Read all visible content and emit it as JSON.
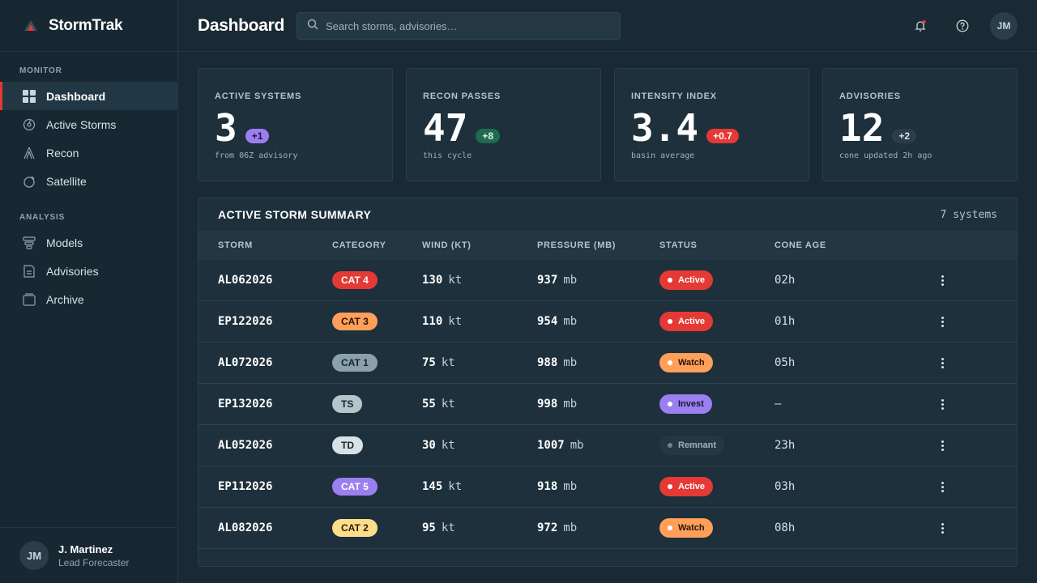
{
  "app": {
    "name": "StormTrak",
    "logo_color": "#e53935"
  },
  "sidebar": {
    "sections": [
      {
        "title": "MONITOR",
        "items": [
          {
            "label": "Dashboard",
            "icon": "grid-icon",
            "active": true
          },
          {
            "label": "Active Storms",
            "icon": "hurricane-icon"
          },
          {
            "label": "Recon",
            "icon": "aircraft-icon"
          },
          {
            "label": "Satellite",
            "icon": "satellite-icon"
          }
        ]
      },
      {
        "title": "ANALYSIS",
        "items": [
          {
            "label": "Models",
            "icon": "models-icon"
          },
          {
            "label": "Advisories",
            "icon": "document-icon"
          },
          {
            "label": "Archive",
            "icon": "archive-icon"
          }
        ]
      }
    ],
    "user": {
      "initials": "JM",
      "name": "J. Martinez",
      "role": "Lead Forecaster"
    }
  },
  "header": {
    "title": "Dashboard",
    "search_placeholder": "Search storms, advisories…",
    "avatar_initials": "JM"
  },
  "stats": [
    {
      "label": "ACTIVE SYSTEMS",
      "value": "3",
      "delta": "+1",
      "delta_bg": "#9b7ff0",
      "delta_fg": "#1a1636",
      "sub": "from 06Z advisory"
    },
    {
      "label": "RECON PASSES",
      "value": "47",
      "delta": "+8",
      "delta_bg": "#1f6b4f",
      "delta_fg": "#d9f5e7",
      "sub": "this cycle"
    },
    {
      "label": "INTENSITY INDEX",
      "value": "3.4",
      "delta": "+0.7",
      "delta_bg": "#e53935",
      "delta_fg": "#ffffff",
      "sub": "basin average"
    },
    {
      "label": "ADVISORIES",
      "value": "12",
      "delta": "+2",
      "delta_bg": "#2a3d49",
      "delta_fg": "#d7e1e6",
      "sub": "cone updated 2h ago"
    }
  ],
  "table": {
    "title": "ACTIVE STORM SUMMARY",
    "count": "7 systems",
    "columns": [
      "STORM",
      "CATEGORY",
      "WIND (KT)",
      "PRESSURE (MB)",
      "STATUS",
      "CONE AGE"
    ],
    "rows": [
      {
        "storm": "AL062026",
        "category": "CAT 4",
        "cat_bg": "#e53935",
        "cat_fg": "#ffffff",
        "wind": "130",
        "wind_unit": "kt",
        "pressure": "937",
        "pressure_unit": "mb",
        "status": "Active",
        "status_bg": "#e53935",
        "status_fg": "#ffffff",
        "dot": "#ffffff",
        "cone": "02h"
      },
      {
        "storm": "EP122026",
        "category": "CAT 3",
        "cat_bg": "#ff9f5a",
        "cat_fg": "#2b1406",
        "wind": "110",
        "wind_unit": "kt",
        "pressure": "954",
        "pressure_unit": "mb",
        "status": "Active",
        "status_bg": "#e53935",
        "status_fg": "#ffffff",
        "dot": "#ffffff",
        "cone": "01h"
      },
      {
        "storm": "AL072026",
        "category": "CAT 1",
        "cat_bg": "#8aa1ad",
        "cat_fg": "#14232b",
        "wind": "75",
        "wind_unit": "kt",
        "pressure": "988",
        "pressure_unit": "mb",
        "status": "Watch",
        "status_bg": "#ff9f5a",
        "status_fg": "#2b1406",
        "dot": "#ffffff",
        "cone": "05h"
      },
      {
        "storm": "EP132026",
        "category": "TS",
        "cat_bg": "#b6c5cc",
        "cat_fg": "#14232b",
        "wind": "55",
        "wind_unit": "kt",
        "pressure": "998",
        "pressure_unit": "mb",
        "status": "Invest",
        "status_bg": "#9b7ff0",
        "status_fg": "#1a1636",
        "dot": "#ffffff",
        "cone": "—"
      },
      {
        "storm": "AL052026",
        "category": "TD",
        "cat_bg": "#d8e2e6",
        "cat_fg": "#14232b",
        "wind": "30",
        "wind_unit": "kt",
        "pressure": "1007",
        "pressure_unit": "mb",
        "status": "Remnant",
        "status_bg": "#243843",
        "status_fg": "#9fb1ba",
        "dot": "#6c8490",
        "cone": "23h"
      },
      {
        "storm": "EP112026",
        "category": "CAT 5",
        "cat_bg": "#9b7ff0",
        "cat_fg": "#ffffff",
        "wind": "145",
        "wind_unit": "kt",
        "pressure": "918",
        "pressure_unit": "mb",
        "status": "Active",
        "status_bg": "#e53935",
        "status_fg": "#ffffff",
        "dot": "#ffffff",
        "cone": "03h"
      },
      {
        "storm": "AL082026",
        "category": "CAT 2",
        "cat_bg": "#ffdc8a",
        "cat_fg": "#2b1f06",
        "wind": "95",
        "wind_unit": "kt",
        "pressure": "972",
        "pressure_unit": "mb",
        "status": "Watch",
        "status_bg": "#ff9f5a",
        "status_fg": "#2b1406",
        "dot": "#ffffff",
        "cone": "08h"
      }
    ]
  }
}
